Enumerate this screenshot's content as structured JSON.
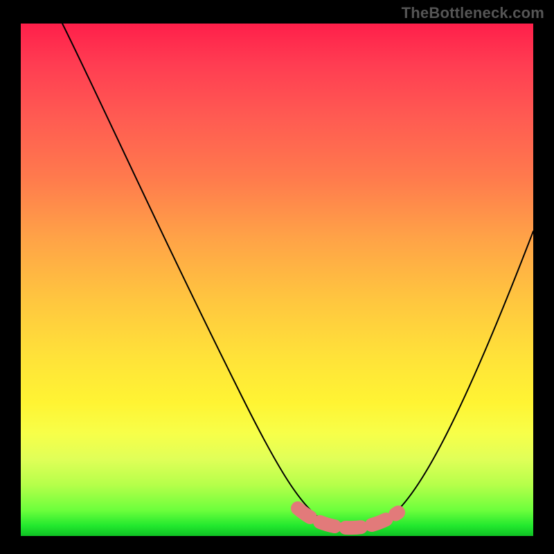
{
  "attribution": "TheBottleneck.com",
  "chart_data": {
    "type": "line",
    "title": "",
    "xlabel": "",
    "ylabel": "",
    "xlim": [
      0,
      100
    ],
    "ylim": [
      0,
      100
    ],
    "grid": false,
    "legend": false,
    "annotations": [],
    "series": [
      {
        "name": "bottleneck-curve",
        "x": [
          8,
          15,
          25,
          35,
          45,
          52,
          58,
          62,
          66,
          70,
          74,
          80,
          88,
          100
        ],
        "y": [
          100,
          88,
          72,
          56,
          38,
          22,
          10,
          4,
          2,
          2,
          4,
          14,
          34,
          62
        ]
      }
    ],
    "highlight": {
      "name": "optimal-range-marker",
      "color": "#e27a7a",
      "x": [
        54,
        58,
        62,
        66,
        70,
        74
      ],
      "y": [
        6,
        3,
        2,
        2,
        3,
        6
      ]
    }
  }
}
